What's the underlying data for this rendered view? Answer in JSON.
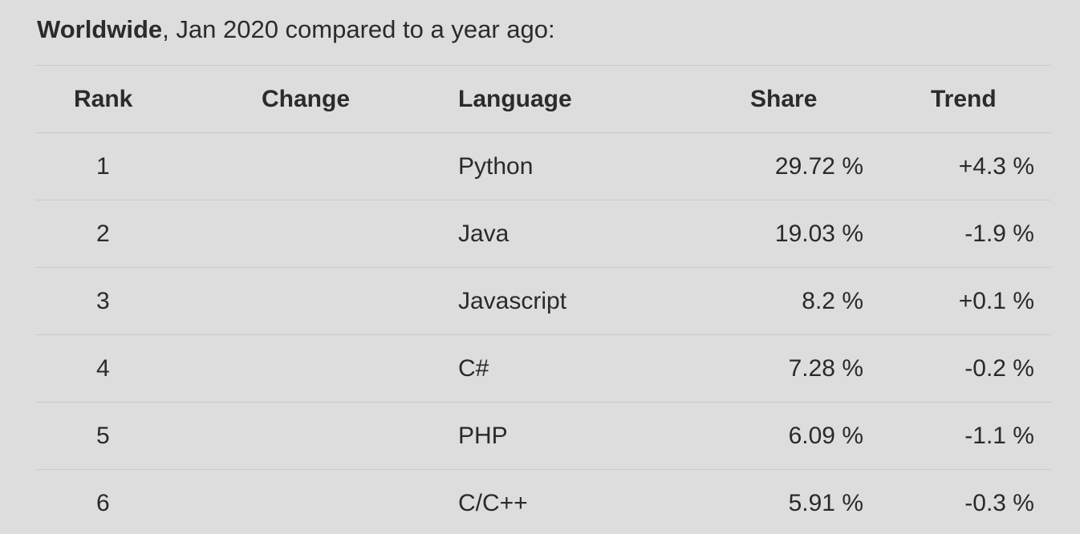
{
  "heading": {
    "bold_part": "Worldwide",
    "rest": ", Jan 2020 compared to a year ago:"
  },
  "table": {
    "headers": {
      "rank": "Rank",
      "change": "Change",
      "language": "Language",
      "share": "Share",
      "trend": "Trend"
    },
    "rows": [
      {
        "rank": "1",
        "change": "",
        "language": "Python",
        "share": "29.72 %",
        "trend": "+4.3 %"
      },
      {
        "rank": "2",
        "change": "",
        "language": "Java",
        "share": "19.03 %",
        "trend": "-1.9 %"
      },
      {
        "rank": "3",
        "change": "",
        "language": "Javascript",
        "share": "8.2 %",
        "trend": "+0.1 %"
      },
      {
        "rank": "4",
        "change": "",
        "language": "C#",
        "share": "7.28 %",
        "trend": "-0.2 %"
      },
      {
        "rank": "5",
        "change": "",
        "language": "PHP",
        "share": "6.09 %",
        "trend": "-1.1 %"
      },
      {
        "rank": "6",
        "change": "",
        "language": "C/C++",
        "share": "5.91 %",
        "trend": "-0.3 %"
      }
    ]
  }
}
